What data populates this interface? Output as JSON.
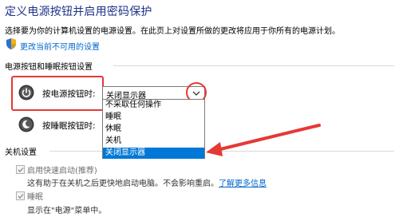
{
  "header": {
    "title": "定义电源按钮并启用密码保护",
    "description": "选择要为你的计算机设置的电源设置。在此页上对设置所做的更改将应用于你所有的电源计划。",
    "change_link": "更改当前不可用的设置"
  },
  "power_section": {
    "label": "电源按钮和睡眠按钮设置",
    "power_button_label": "按电源按钮时:",
    "power_button_value": "关闭显示器",
    "sleep_button_label": "按睡眠按钮时:",
    "dropdown_options": [
      "不采取任何操作",
      "睡眠",
      "休眠",
      "关机",
      "关闭显示器"
    ],
    "selected_option": "关闭显示器"
  },
  "shutdown_section": {
    "label": "关机设置",
    "fast_startup_label": "启用快速启动(推荐)",
    "fast_startup_desc": "这有助于在关机之后更快地启动电脑。不会影响重启。",
    "learn_more": "了解更多信息",
    "sleep_label": "睡眠",
    "sleep_desc": "显示在\"电源\"菜单中。"
  },
  "colors": {
    "title": "#1e3287",
    "link": "#0066cc",
    "highlight": "#e53935",
    "selection": "#0078d7"
  },
  "icons": [
    "shield-icon",
    "power-icon",
    "moon-icon",
    "chevron-down-icon",
    "check-icon"
  ]
}
